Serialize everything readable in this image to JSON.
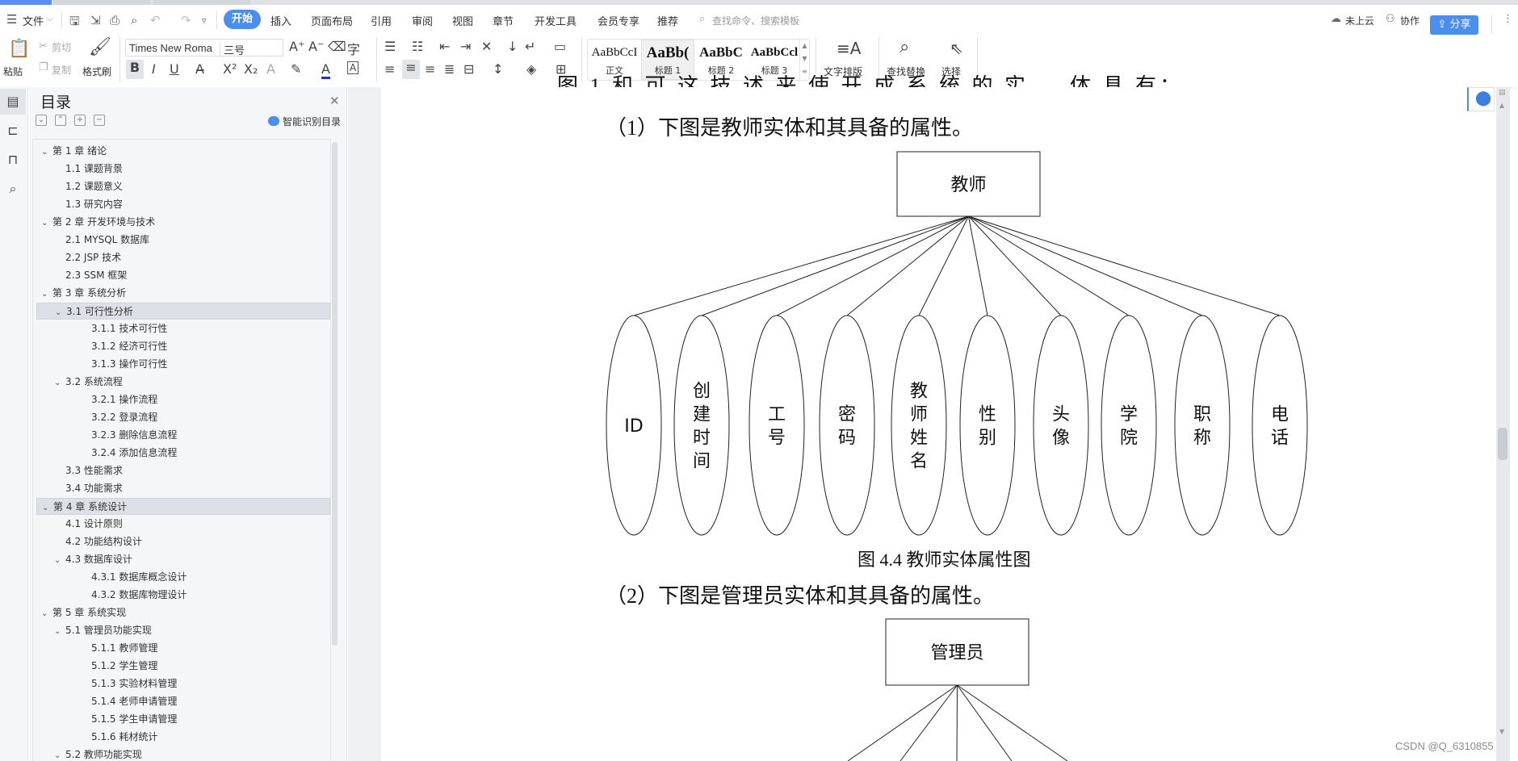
{
  "menubar": {
    "file_label": "文件",
    "tabs": [
      "开始",
      "插入",
      "页面布局",
      "引用",
      "审阅",
      "视图",
      "章节",
      "开发工具",
      "会员专享",
      "推荐"
    ],
    "active_tab": "开始",
    "search_placeholder": "查找命令、搜索模板",
    "cloud_status": "未上云",
    "collab_label": "协作",
    "share_label": "分享"
  },
  "ribbon": {
    "paste": "粘贴",
    "cut": "剪切",
    "copy": "复制",
    "format_painter": "格式刷",
    "font_name": "Times New Roma",
    "font_size": "三号",
    "styles": [
      {
        "preview": "AaBbCcI",
        "name": "正文"
      },
      {
        "preview": "AaBb(",
        "name": "标题 1"
      },
      {
        "preview": "AaBbC",
        "name": "标题 2"
      },
      {
        "preview": "AaBbCcl",
        "name": "标题 3"
      }
    ],
    "text_layout": "文字排版",
    "find_replace": "查找替换",
    "select": "选择"
  },
  "toc": {
    "title": "目录",
    "smart_label": "智能识别目录",
    "items": [
      {
        "level": 1,
        "text": "第 1 章  绪论",
        "expanded": true
      },
      {
        "level": 2,
        "text": "1.1  课题背景"
      },
      {
        "level": 2,
        "text": "1.2  课题意义"
      },
      {
        "level": 2,
        "text": "1.3  研究内容"
      },
      {
        "level": 1,
        "text": "第 2 章  开发环境与技术",
        "expanded": true
      },
      {
        "level": 2,
        "text": "2.1 MYSQL 数据库"
      },
      {
        "level": 2,
        "text": "2.2 JSP 技术"
      },
      {
        "level": 2,
        "text": "2.3 SSM 框架"
      },
      {
        "level": 1,
        "text": "第 3 章  系统分析",
        "expanded": true
      },
      {
        "level": 2,
        "text": "3.1  可行性分析",
        "expanded": true,
        "highlight": true
      },
      {
        "level": 3,
        "text": "3.1.1  技术可行性"
      },
      {
        "level": 3,
        "text": "3.1.2  经济可行性"
      },
      {
        "level": 3,
        "text": "3.1.3  操作可行性"
      },
      {
        "level": 2,
        "text": "3.2  系统流程",
        "expanded": true
      },
      {
        "level": 3,
        "text": "3.2.1  操作流程"
      },
      {
        "level": 3,
        "text": "3.2.2  登录流程"
      },
      {
        "level": 3,
        "text": "3.2.3  删除信息流程"
      },
      {
        "level": 3,
        "text": "3.2.4  添加信息流程"
      },
      {
        "level": 2,
        "text": "3.3  性能需求"
      },
      {
        "level": 2,
        "text": "3.4  功能需求"
      },
      {
        "level": 1,
        "text": "第 4 章  系统设计",
        "expanded": true,
        "highlight": true
      },
      {
        "level": 2,
        "text": "4.1  设计原则"
      },
      {
        "level": 2,
        "text": "4.2  功能结构设计"
      },
      {
        "level": 2,
        "text": "4.3  数据库设计",
        "expanded": true
      },
      {
        "level": 3,
        "text": "4.3.1  数据库概念设计"
      },
      {
        "level": 3,
        "text": "4.3.2  数据库物理设计"
      },
      {
        "level": 1,
        "text": "第 5 章  系统实现",
        "expanded": true
      },
      {
        "level": 2,
        "text": "5.1  管理员功能实现",
        "expanded": true
      },
      {
        "level": 3,
        "text": "5.1.1  教师管理"
      },
      {
        "level": 3,
        "text": "5.1.2  学生管理"
      },
      {
        "level": 3,
        "text": "5.1.3  实验材料管理"
      },
      {
        "level": 3,
        "text": "5.1.4  老师申请管理"
      },
      {
        "level": 3,
        "text": "5.1.5  学生申请管理"
      },
      {
        "level": 3,
        "text": "5.1.6  耗材统计"
      },
      {
        "level": 2,
        "text": "5.2  教师功能实现",
        "expanded": true
      }
    ]
  },
  "document": {
    "para1": "（1）下图是教师实体和其具备的属性。",
    "figure1": {
      "entity": "教师",
      "attributes": [
        "ID",
        "创建时间",
        "工号",
        "密码",
        "教师姓名",
        "性别",
        "头像",
        "学院",
        "职称",
        "电话"
      ],
      "caption": "图 4.4  教师实体属性图"
    },
    "para2": "（2）下图是管理员实体和其具备的属性。",
    "figure2": {
      "entity": "管理员"
    }
  },
  "watermark": "CSDN @Q_6310855"
}
